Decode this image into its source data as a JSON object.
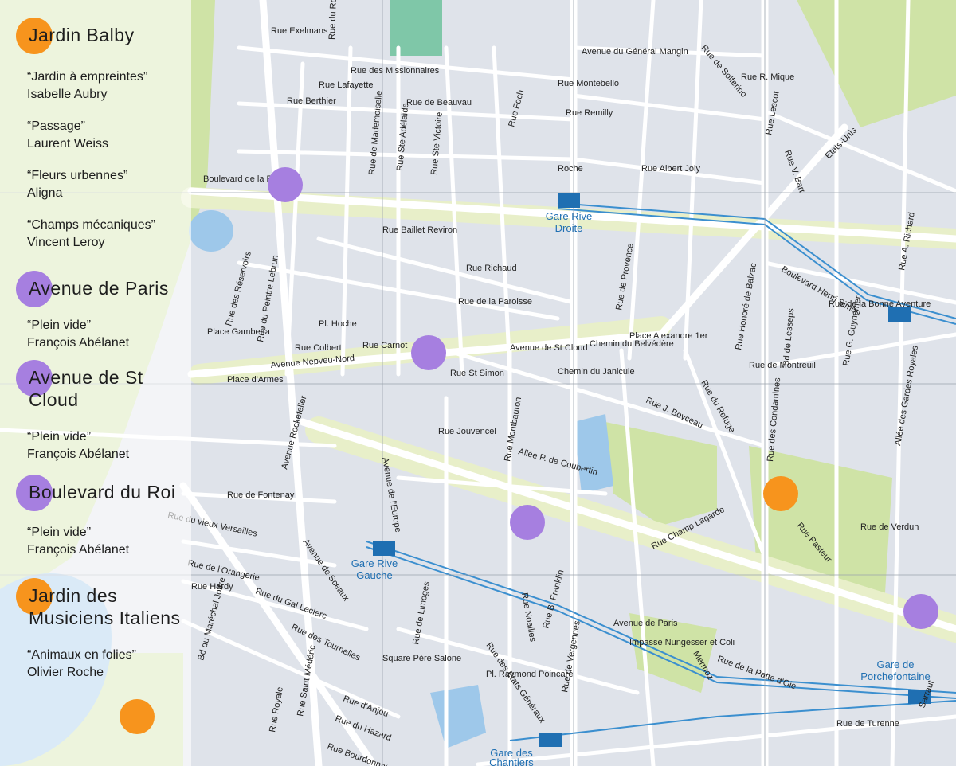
{
  "colors": {
    "orange_marker": "#f7941d",
    "purple_marker": "#a67fe0",
    "station_blue": "#1f6fb2",
    "park_green": "#cfe3a6",
    "water_blue": "#9ec8ea"
  },
  "legend": [
    {
      "name": "Jardin Balby",
      "color": "orange",
      "works": [
        {
          "title": "“Jardin à empreintes”",
          "artist": "Isabelle Aubry"
        },
        {
          "title": "“Passage”",
          "artist": "Laurent Weiss"
        },
        {
          "title": "“Fleurs urbennes”",
          "artist": "Aligna"
        },
        {
          "title": "“Champs mécaniques”",
          "artist": "Vincent Leroy"
        }
      ]
    },
    {
      "name": "Avenue de Paris",
      "color": "purple",
      "works": [
        {
          "title": "“Plein vide”",
          "artist": "François Abélanet"
        }
      ]
    },
    {
      "name": "Avenue de St Cloud",
      "color": "purple",
      "works": [
        {
          "title": "“Plein vide”",
          "artist": "François Abélanet"
        }
      ]
    },
    {
      "name": "Boulevard du Roi",
      "color": "purple",
      "works": [
        {
          "title": "“Plein vide”",
          "artist": "François Abélanet"
        }
      ]
    },
    {
      "name": "Jardin des Musiciens Italiens",
      "color": "orange",
      "works": [
        {
          "title": "“Animaux en folies”",
          "artist": "Olivier Roche"
        }
      ]
    }
  ],
  "stations": {
    "rive_droite": [
      "Gare Rive",
      "Droite"
    ],
    "rive_gauche": [
      "Gare Rive",
      "Gauche"
    ],
    "porchefontaine": [
      "Gare de",
      "Porchefontaine"
    ],
    "chantiers": [
      "Gare des",
      "Chantiers"
    ]
  },
  "streets": {
    "av_paris": "Avenue de Paris",
    "av_st_cloud": "Avenue de St Cloud",
    "bd_reine": "Boulevard de la Reine",
    "rue_roi": "Rue du Roi",
    "gen_mangin": "Avenue du Général Mangin",
    "montebello": "Rue Montebello",
    "remilly": "Rue Remilly",
    "albert_joly": "Rue Albert Joly",
    "exelmans": "Rue Exelmans",
    "missionnaires": "Rue des Missionnaires",
    "beauvau": "Rue de Beauvau",
    "berthier": "Rue Berthier",
    "lafayette": "Rue Lafayette",
    "baillet": "Rue Baillet Reviron",
    "richaud": "Rue Richaud",
    "paroisse": "Rue de la Paroisse",
    "carnot": "Rue Carnot",
    "provence": "Rue de Provence",
    "montreuil": "Rue de Montreuil",
    "st_simon": "Rue St Simon",
    "jouvencel": "Rue Jouvencel",
    "coubertin": "Allée P. de Coubertin",
    "fontenay": "Rue de Fontenay",
    "orangerie": "Rue de l'Orangerie",
    "vieux_versailles": "Rue du vieux Versailles",
    "hardy": "Rue Hardy",
    "leclerc": "Rue du Gal Leclerc",
    "tournelles": "Rue des Tournelles",
    "anjou": "Rue d'Anjou",
    "hazard": "Rue du Hazard",
    "bourdonnais": "Rue Bourdonnais",
    "etats_generaux": "Rue des Etats Généraux",
    "champ_lagarde": "Rue Champ Lagarde",
    "pasteur": "Rue Pasteur",
    "verdun": "Rue de Verdun",
    "turenne": "Rue de Turenne",
    "sarraut": "Sarraut",
    "condamines": "Rue des Condamines",
    "refuge": "Rue du Refuge",
    "boyceau": "Rue J. Boyceau",
    "balzac": "Rue Honoré de Balzac",
    "montbauron": "Rue Montbauron",
    "solferino": "Rue de Solferino",
    "mique": "Rue R. Mique",
    "lescot": "Rue Lescot",
    "bart": "Rue V. Bart",
    "richard": "Rue A. Richard",
    "bonne_aventure": "Rue de la Bonne Aventure",
    "gardes": "Allée des Gardes Royales",
    "mermoz": "Mermoz",
    "patte_oie": "Rue de la Patte d'Oie",
    "nungesser": "Impasse Nungesser et Coli",
    "gambetta": "Place Gambetta",
    "hoche": "Pl. Hoche",
    "armes": "Place d'Armes",
    "alexandre": "Place Alexandre 1er",
    "colbert": "Rue Colbert",
    "nepveu": "Avenue Nepveu-Nord",
    "rockefeller": "Avenue Rockefeller",
    "sceaux": "Avenue de Sceaux",
    "europe": "Avenue de l'Europe",
    "vergennes": "Rue de Vergennes",
    "franklin": "Rue B. Franklin",
    "noailles": "Rue Noailles",
    "limoges": "Rue de Limoges",
    "reservoirs": "Rue des Réservoirs",
    "peintre_lebrun": "Rue du Peintre Lebrun",
    "sainte_adelaide": "Rue Ste Adélaïde",
    "ste_victoire": "Rue Ste Victoire",
    "mademoiselle": "Rue de Mademoiselle",
    "foch": "Rue Foch",
    "chemin_belvedere": "Chemin du Belvédère",
    "chemin_janicule": "Chemin du Janicule",
    "joffre": "Bd du Maréchal Joffre",
    "roche": "Roche",
    "st_mederic": "Rue Saint Médéric",
    "royale": "Rue Royale",
    "pere_salone": "Square Père Salone",
    "raymond_poincare": "Pl. Raymond Poincaré",
    "lesseps": "Bd de Lesseps",
    "gynemer": "Rue G. Guynemer",
    "henri_simon": "Boulevard Henri Simon",
    "etats_unis": "Etats-Unis"
  }
}
